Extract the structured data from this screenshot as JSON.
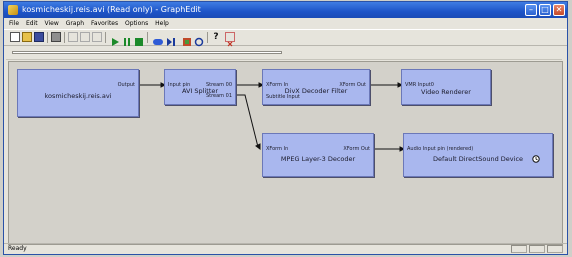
{
  "window": {
    "title": "kosmicheskij.reis.avi (Read only) - GraphEdit"
  },
  "menu": [
    "File",
    "Edit",
    "View",
    "Graph",
    "Favorites",
    "Options",
    "Help"
  ],
  "toolbar": {
    "icons": [
      "new-icon",
      "open-icon",
      "save-icon",
      "print-icon",
      "cut-icon",
      "copy-icon",
      "paste-icon",
      "play-icon",
      "pause-icon",
      "stop-icon",
      "seek-icon",
      "frame-step-icon",
      "filter-icon",
      "refresh-icon",
      "help-icon",
      "delete-icon"
    ]
  },
  "filters": {
    "source": {
      "name": "kosmicheskij.reis.avi",
      "pin_out": "Output"
    },
    "splitter": {
      "name": "AVI Splitter",
      "pin_in": "Input pin",
      "pin_out_0": "Stream 00",
      "pin_out_1": "Stream 01"
    },
    "divx": {
      "name": "DivX Decoder Filter",
      "pin_in": "XForm In",
      "pin_in2": "Subtitle Input",
      "pin_out": "XForm Out"
    },
    "renderer": {
      "name": "Video Renderer",
      "pin_in": "VMR Input0"
    },
    "mpeg": {
      "name": "MPEG Layer-3 Decoder",
      "pin_in": "XForm In",
      "pin_out": "XForm Out"
    },
    "sound": {
      "name": "Default DirectSound Device",
      "pin_in": "Audio Input pin (rendered)"
    }
  },
  "status": {
    "text": "Ready"
  },
  "colors": {
    "titlebar": "#1d54c8",
    "filter_fill": "#a9b7ee",
    "canvas": "#d3d1ca"
  }
}
